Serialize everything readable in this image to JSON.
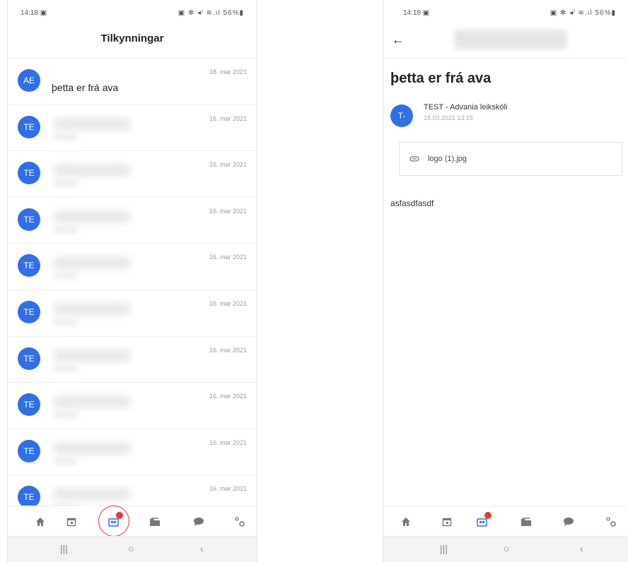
{
  "left": {
    "status": {
      "time": "14:18 ▣",
      "icons": "▣ ✻ ◂ᴵ ≋.ıl 56%▮"
    },
    "title": "Tilkynningar",
    "items": [
      {
        "avatar": "AE",
        "title": "þetta er frá ava",
        "date": "18. mar 2021"
      },
      {
        "avatar": "TE",
        "title": "",
        "date": "16. mar 2021"
      },
      {
        "avatar": "TE",
        "title": "",
        "date": "16. mar 2021"
      },
      {
        "avatar": "TE",
        "title": "",
        "date": "16. mar 2021"
      },
      {
        "avatar": "TE",
        "title": "",
        "date": "16. mar 2021"
      },
      {
        "avatar": "TE",
        "title": "",
        "date": "16. mar 2021"
      },
      {
        "avatar": "TE",
        "title": "",
        "date": "16. mar 2021"
      },
      {
        "avatar": "TE",
        "title": "",
        "date": "16. mar 2021"
      },
      {
        "avatar": "TE",
        "title": "",
        "date": "16. mar 2021"
      },
      {
        "avatar": "TE",
        "title": "",
        "date": "16. mar 2021"
      }
    ],
    "tabs": [
      "home-icon",
      "calendar-icon",
      "notifications-icon",
      "folder-icon",
      "chat-icon",
      "settings-icon"
    ],
    "badge_color": "#e53935",
    "highlight_color": "#e03030"
  },
  "right": {
    "status": {
      "time": "14:18 ▣",
      "icons": "▣ ✻ ◂ᴵ ≋.ıl 56%▮"
    },
    "title": "þetta er frá ava",
    "sender": {
      "avatar": "T-",
      "name": "TEST - Advania leikskóli",
      "time": "18.03.2021 13:15"
    },
    "attachment": "logo (1).jpg",
    "body": "asfasdfasdf"
  },
  "nav": {
    "recents": "|||",
    "home": "○",
    "back": "‹"
  },
  "accent": "#2f6fe8"
}
